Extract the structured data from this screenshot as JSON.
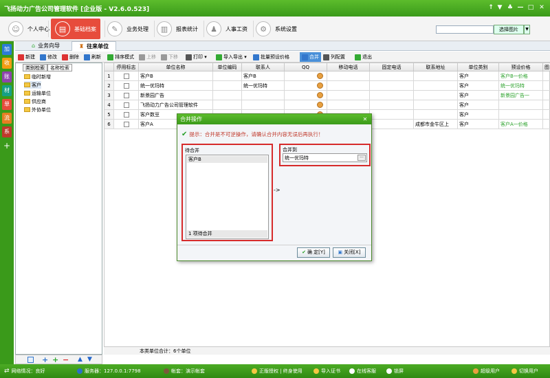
{
  "titlebar": {
    "title": "飞扬动力广告公司管理软件 [企业版 - V2.6.0.523]",
    "controls": [
      "↑",
      "▼",
      "♣",
      "—",
      "□",
      "✕"
    ]
  },
  "modules": [
    {
      "label": "个人中心",
      "icon": "person-icon"
    },
    {
      "label": "基础档案",
      "icon": "archive-icon",
      "active": true
    },
    {
      "label": "业务处理",
      "icon": "business-icon"
    },
    {
      "label": "报表统计",
      "icon": "chart-icon"
    },
    {
      "label": "人事工资",
      "icon": "hr-icon"
    },
    {
      "label": "系统设置",
      "icon": "settings-icon"
    }
  ],
  "header": {
    "search_value": "",
    "pick_image": "选择图片",
    "pick_drop": "▼"
  },
  "vbar": [
    "加",
    "收",
    "账",
    "材",
    "单",
    "流",
    "系",
    "+"
  ],
  "tabs": [
    {
      "label": "业务向导",
      "icon": "home-icon"
    },
    {
      "label": "往来单位",
      "icon": "unit-icon",
      "active": true
    }
  ],
  "toolbar": [
    {
      "label": "新建",
      "color": "#d33"
    },
    {
      "label": "修改",
      "color": "#37c"
    },
    {
      "label": "删除",
      "color": "#d33"
    },
    {
      "label": "刷新",
      "color": "#37c"
    },
    {
      "label": "排序模式",
      "color": "#3a3"
    },
    {
      "label": "上移",
      "color": "#999",
      "disabled": true
    },
    {
      "label": "下移",
      "color": "#999",
      "disabled": true
    },
    {
      "label": "打印 ▾",
      "color": "#555"
    },
    {
      "label": "导入导出 ▾",
      "color": "#3a3"
    },
    {
      "label": "批量预设价格",
      "color": "#37c"
    },
    {
      "label": "合并",
      "color": "#37c",
      "active": true
    },
    {
      "label": "列配置",
      "color": "#555"
    },
    {
      "label": "退出",
      "color": "#3a3"
    }
  ],
  "tree": {
    "tabs": [
      "类别检索",
      "名称检索"
    ],
    "nodes": [
      "临时新增",
      "客户",
      "运输单位",
      "供应商",
      "外协单位"
    ],
    "bottom_icons": [
      "edit-icon",
      "add-icon",
      "add-green-icon",
      "remove-icon",
      "up-icon",
      "down-icon"
    ]
  },
  "grid": {
    "columns": [
      "",
      "停用标志",
      "单位名称",
      "单位编码",
      "联系人",
      "QQ",
      "移动电话",
      "固定电话",
      "联系地址",
      "单位类别",
      "预设价格",
      "图"
    ],
    "rows": [
      {
        "no": "1",
        "name": "客户B",
        "code": "",
        "contact": "客户B",
        "mobile": "",
        "phone": "",
        "address": "",
        "category": "客户",
        "price": "客户B一价格"
      },
      {
        "no": "2",
        "name": "统一优玛特",
        "code": "",
        "contact": "统一优玛特",
        "mobile": "",
        "phone": "",
        "address": "",
        "category": "客户",
        "price": "统一优玛特"
      },
      {
        "no": "3",
        "name": "新景园广告",
        "code": "",
        "contact": "",
        "mobile": "",
        "phone": "",
        "address": "",
        "category": "客户",
        "price": "新景园广告一"
      },
      {
        "no": "4",
        "name": "飞扬动力广告公司管理软件",
        "code": "",
        "contact": "",
        "mobile": "",
        "phone": "",
        "address": "",
        "category": "客户",
        "price": ""
      },
      {
        "no": "5",
        "name": "客户数豆",
        "code": "",
        "contact": "",
        "mobile": "",
        "phone": "",
        "address": "",
        "category": "客户",
        "price": ""
      },
      {
        "no": "6",
        "name": "客户A",
        "code": "",
        "contact": "",
        "mobile": "",
        "phone": "",
        "address": "成都市金牛区上",
        "category": "客户",
        "price": "客户A一价格"
      }
    ],
    "footer": "本类单位合计：6个单位"
  },
  "status": {
    "network": "网络情况：良好",
    "server": "服务器：127.0.0.1:7798",
    "account": "帐套：演示帐套",
    "license": "正版授权 | 终身使用",
    "import_cert": "导入证书",
    "online_service": "在线客服",
    "lock": "锁屏",
    "user": "超级用户",
    "switch_user": "切换用户"
  },
  "dialog": {
    "title": "合并操作",
    "close": "✕",
    "tip": "提示：合并是不可逆操作，请确认合并内容无误后再执行！",
    "source_label": "待合并",
    "source_items": [
      "客户B"
    ],
    "source_footer": "1 项待合并",
    "arrow": "->",
    "target_label": "合并到",
    "target_value": "统一优玛特",
    "target_dots": "···",
    "ok": "确 定[Y]",
    "close_btn": "关闭[X]"
  }
}
